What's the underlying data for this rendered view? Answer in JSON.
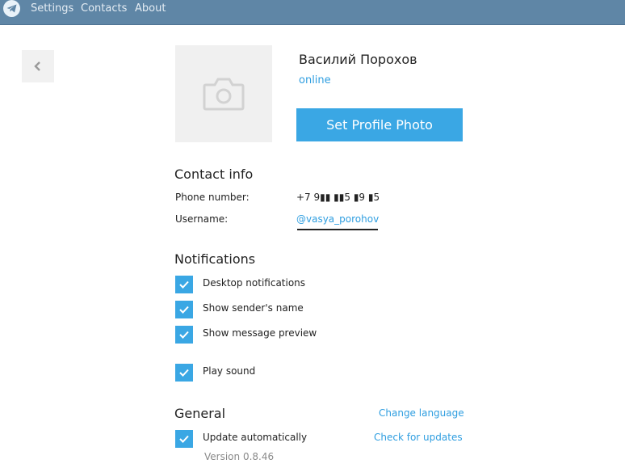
{
  "menu": {
    "items": [
      "Settings",
      "Contacts",
      "About"
    ]
  },
  "profile": {
    "name": "Василий Порохов",
    "status": "online",
    "set_photo_label": "Set Profile Photo"
  },
  "contact_info": {
    "title": "Contact info",
    "phone_label": "Phone number:",
    "phone_value": "+7 9▮▮ ▮▮5 ▮9 ▮5",
    "username_label": "Username:",
    "username_value": "@vasya_porohov"
  },
  "notifications": {
    "title": "Notifications",
    "items": [
      {
        "label": "Desktop notifications",
        "checked": true
      },
      {
        "label": "Show sender's name",
        "checked": true
      },
      {
        "label": "Show message preview",
        "checked": true
      },
      {
        "label": "Play sound",
        "checked": true
      }
    ]
  },
  "general": {
    "title": "General",
    "change_language": "Change language",
    "update_label": "Update automatically",
    "update_checked": true,
    "check_updates": "Check for updates",
    "version": "Version 0.8.46"
  },
  "colors": {
    "topbar": "#5f86a6",
    "accent": "#3aa7e4",
    "link": "#2f9ee0"
  }
}
